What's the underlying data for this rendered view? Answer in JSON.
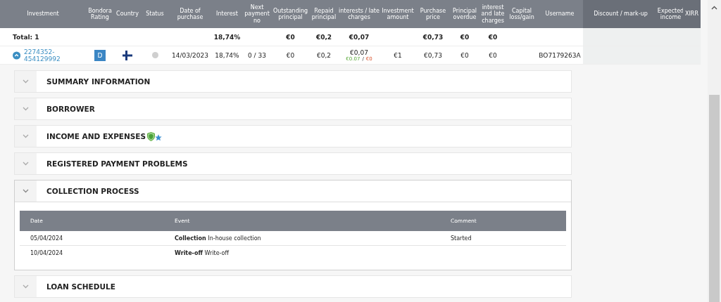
{
  "table": {
    "columns": [
      {
        "label": "Investment",
        "highlighted": false
      },
      {
        "label": "Bondora Rating",
        "highlighted": false
      },
      {
        "label": "Country",
        "highlighted": false
      },
      {
        "label": "Status",
        "highlighted": false
      },
      {
        "label": "Date of purchase",
        "highlighted": false
      },
      {
        "label": "Interest",
        "highlighted": false
      },
      {
        "label": "Next payment no",
        "highlighted": false
      },
      {
        "label": "Outstanding principal",
        "highlighted": false
      },
      {
        "label": "Repaid principal",
        "highlighted": false
      },
      {
        "label": "interests / late charges",
        "highlighted": false
      },
      {
        "label": "Investment amount",
        "highlighted": false
      },
      {
        "label": "Purchase price",
        "highlighted": false
      },
      {
        "label": "Principal overdue",
        "highlighted": false
      },
      {
        "label": "interest and late charges",
        "highlighted": false
      },
      {
        "label": "Capital loss/gain",
        "highlighted": false
      },
      {
        "label": "Username",
        "highlighted": false
      },
      {
        "label": "Discount / mark-up",
        "highlighted": true
      },
      {
        "label": "Expected income",
        "highlighted": true
      },
      {
        "label": "XIRR",
        "highlighted": true
      }
    ],
    "rows": [
      {
        "kind": "total",
        "cells": [
          "Total: 1",
          null,
          null,
          null,
          null,
          "18,74%",
          null,
          "€0",
          "€0,2",
          "€0,07",
          null,
          "€0,73",
          "€0",
          "€0",
          null,
          null,
          null,
          null,
          null
        ]
      },
      {
        "kind": "loan",
        "cells": [
          {
            "kind": "link",
            "text": "2274352-454129992",
            "expanded": true
          },
          {
            "kind": "badge",
            "text": "D"
          },
          {
            "kind": "flag"
          },
          {
            "kind": "dot"
          },
          "14/03/2023",
          "18,74%",
          "0 / 33",
          "€0",
          "€0,2",
          {
            "kind": "split",
            "text": "€0,07",
            "received": "€0.07",
            "separator": "/",
            "due": "€0"
          },
          "€1",
          "€0,73",
          "€0",
          "€0",
          null,
          "BO7179263A",
          null,
          null,
          null
        ]
      }
    ]
  },
  "sections": [
    {
      "title": "SUMMARY INFORMATION",
      "expanded": false,
      "verified": false
    },
    {
      "title": "BORROWER",
      "expanded": false,
      "verified": false
    },
    {
      "title": "INCOME AND EXPENSES",
      "expanded": false,
      "verified": true
    },
    {
      "title": "REGISTERED PAYMENT PROBLEMS",
      "expanded": false,
      "verified": false
    },
    {
      "title": "COLLECTION PROCESS",
      "expanded": true,
      "verified": false,
      "table": {
        "columns": [
          "Date",
          "Event",
          "Comment"
        ],
        "rows": [
          {
            "date": "05/04/2024",
            "event": "**Collection** In-house collection",
            "comment": "Started"
          },
          {
            "date": "10/04/2024",
            "event": "**Write-off** Write-off"
          }
        ]
      }
    },
    {
      "title": "LOAN SCHEDULE",
      "expanded": false,
      "verified": false
    }
  ]
}
